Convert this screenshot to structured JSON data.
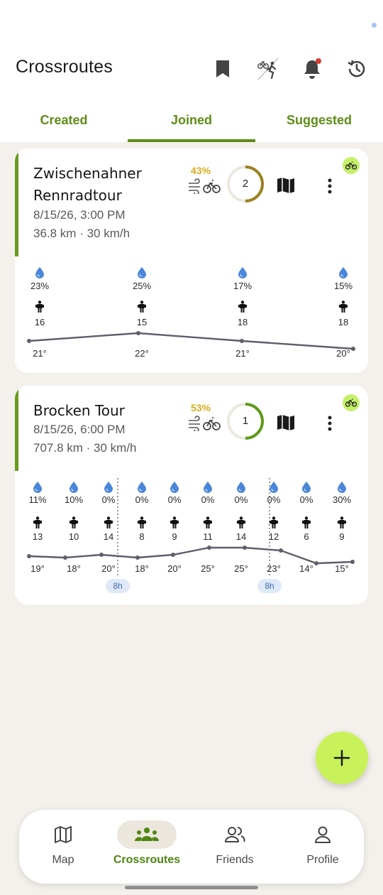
{
  "app": {
    "title": "Crossroutes"
  },
  "header_icons": [
    "bookmark-icon",
    "activity-filter-icon",
    "notification-bell-icon",
    "history-icon"
  ],
  "tabs": [
    {
      "label": "Created",
      "active": false
    },
    {
      "label": "Joined",
      "active": true
    },
    {
      "label": "Suggested",
      "active": false
    }
  ],
  "colors": {
    "accent_green": "#5e8d17",
    "fab": "#c9f25a",
    "percent_yellow": "#d6ad1e",
    "rain_blue": "#4a86d9",
    "chip_bg": "#dfe9f8"
  },
  "cards": [
    {
      "title_line1": "Zwischenahner",
      "title_line2": "Rennradtour",
      "datetime": "8/15/26, 3:00 PM",
      "stats": "36.8 km · 30 km/h",
      "wind_pct": "43%",
      "participants": "2",
      "progress": 0.5,
      "activity": "cycling",
      "weather": [
        {
          "rain": "23%",
          "wind": "16",
          "temp": "21°"
        },
        {
          "rain": "25%",
          "wind": "15",
          "temp": "22°"
        },
        {
          "rain": "17%",
          "wind": "18",
          "temp": "21°"
        },
        {
          "rain": "15%",
          "wind": "18",
          "temp": "20°"
        }
      ],
      "temp_values": [
        21,
        22,
        21,
        20
      ]
    },
    {
      "title_line1": "Brocken Tour",
      "datetime": "8/15/26, 6:00 PM",
      "stats": "707.8 km · 30 km/h",
      "wind_pct": "53%",
      "participants": "1",
      "progress": 0.5,
      "activity": "cycling",
      "weather": [
        {
          "rain": "11%",
          "wind": "13",
          "temp": "19°"
        },
        {
          "rain": "10%",
          "wind": "10",
          "temp": "18°"
        },
        {
          "rain": "0%",
          "wind": "14",
          "temp": "20°"
        },
        {
          "rain": "0%",
          "wind": "8",
          "temp": "18°"
        },
        {
          "rain": "0%",
          "wind": "9",
          "temp": "20°"
        },
        {
          "rain": "0%",
          "wind": "11",
          "temp": "25°"
        },
        {
          "rain": "0%",
          "wind": "14",
          "temp": "25°"
        },
        {
          "rain": "0%",
          "wind": "12",
          "temp": "23°"
        },
        {
          "rain": "0%",
          "wind": "6",
          "temp": "14°"
        },
        {
          "rain": "30%",
          "wind": "9",
          "temp": "15°"
        }
      ],
      "temp_values": [
        19,
        18,
        20,
        18,
        20,
        25,
        25,
        23,
        14,
        15
      ],
      "hour_markers": [
        "8h",
        "8h"
      ]
    }
  ],
  "fab": {
    "icon": "plus-icon"
  },
  "nav": [
    {
      "label": "Map",
      "icon": "map-icon",
      "active": false
    },
    {
      "label": "Crossroutes",
      "icon": "group-icon",
      "active": true
    },
    {
      "label": "Friends",
      "icon": "friends-icon",
      "active": false
    },
    {
      "label": "Profile",
      "icon": "profile-icon",
      "active": false
    }
  ]
}
